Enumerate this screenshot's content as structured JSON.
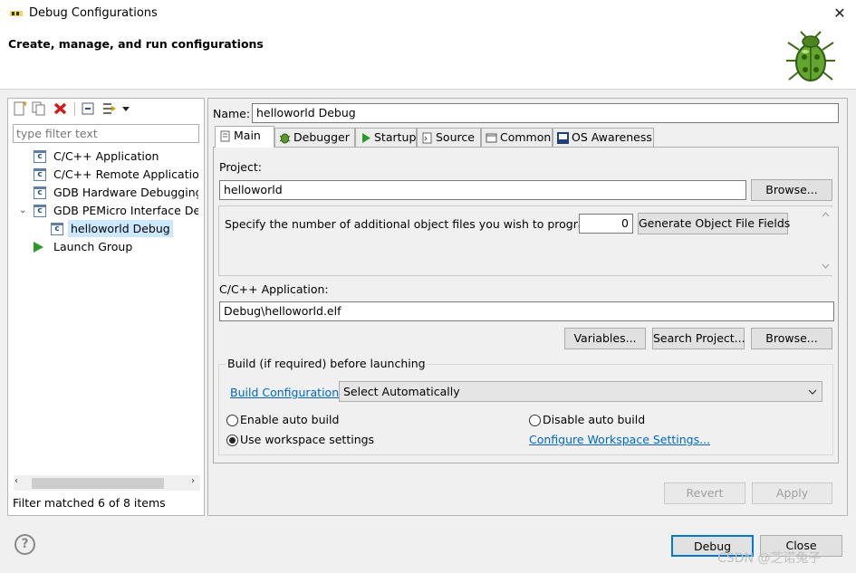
{
  "window": {
    "title": "Debug Configurations",
    "close_glyph": "✕"
  },
  "header": {
    "title": "Create, manage, and run configurations"
  },
  "left": {
    "filter_placeholder": "type filter text",
    "tree": [
      {
        "label": "C/C++ Application",
        "icon": "c-config-icon",
        "level": 1,
        "expanded": null,
        "selected": false
      },
      {
        "label": "C/C++ Remote Application",
        "icon": "c-config-icon",
        "level": 1,
        "expanded": null,
        "selected": false
      },
      {
        "label": "GDB Hardware Debugging",
        "icon": "c-config-icon",
        "level": 1,
        "expanded": null,
        "selected": false
      },
      {
        "label": "GDB PEMicro Interface Debugging",
        "icon": "c-config-icon",
        "level": 1,
        "expanded": true,
        "selected": false
      },
      {
        "label": "helloworld Debug",
        "icon": "c-config-icon",
        "level": 2,
        "expanded": null,
        "selected": true
      },
      {
        "label": "Launch Group",
        "icon": "launch-group-icon",
        "level": 1,
        "expanded": null,
        "selected": false
      }
    ],
    "status": "Filter matched 6 of 8 items"
  },
  "right": {
    "name_label": "Name:",
    "name_value": "helloworld Debug",
    "tabs": [
      {
        "label": "Main",
        "icon": "main-tab-icon",
        "active": true
      },
      {
        "label": "Debugger",
        "icon": "debugger-bug-icon",
        "active": false
      },
      {
        "label": "Startup",
        "icon": "startup-play-icon",
        "active": false
      },
      {
        "label": "Source",
        "icon": "source-icon",
        "active": false
      },
      {
        "label": "Common",
        "icon": "common-icon",
        "active": false
      },
      {
        "label": "OS Awareness",
        "icon": "os-awareness-icon",
        "active": false
      }
    ],
    "project_label": "Project:",
    "project_value": "helloworld",
    "browse_label": "Browse...",
    "objfiles_label": "Specify the number of additional object files you wish to program:",
    "objfiles_value": "0",
    "generate_label": "Generate Object File Fields",
    "app_label": "C/C++ Application:",
    "app_value": "Debug\\helloworld.elf",
    "variables_label": "Variables...",
    "search_label": "Search Project...",
    "browse2_label": "Browse...",
    "build_group_label": "Build (if required) before launching",
    "build_config_link": "Build Configuration:",
    "build_config_value": "Select Automatically",
    "radio_enable": "Enable auto build",
    "radio_disable": "Disable auto build",
    "radio_workspace": "Use workspace settings",
    "configure_link": "Configure Workspace Settings...",
    "revert_label": "Revert",
    "apply_label": "Apply"
  },
  "footer": {
    "debug_label": "Debug",
    "close_label": "Close",
    "help_glyph": "?"
  },
  "watermark": "CSDN @芝诺兔子"
}
